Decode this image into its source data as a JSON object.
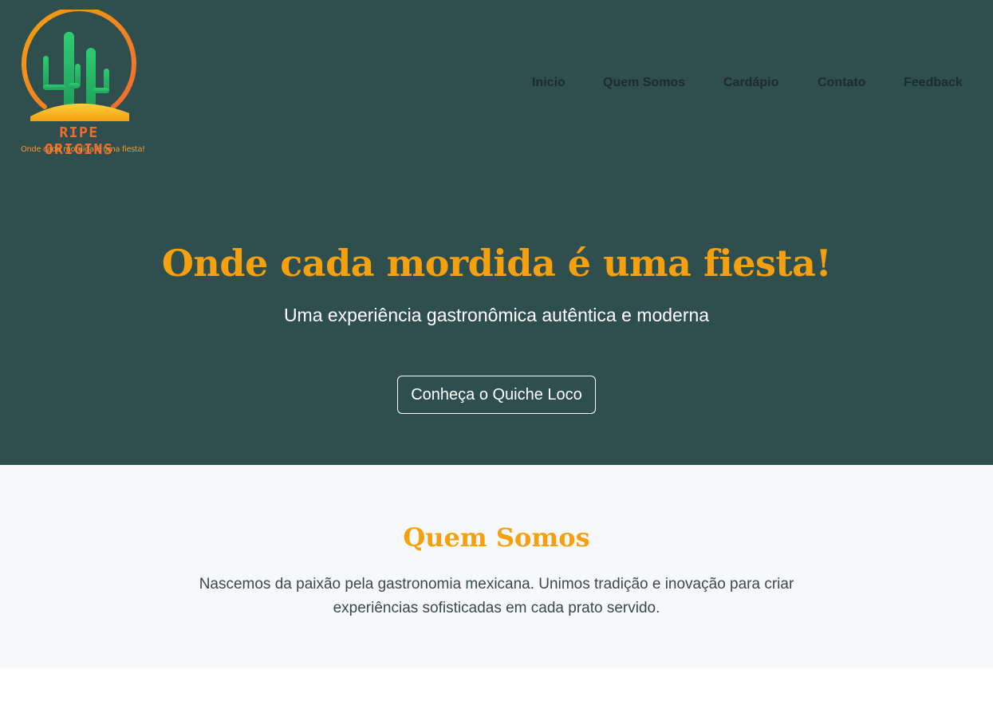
{
  "brand": {
    "name": "RIPE ORIGINS",
    "tagline": "Onde cada mordida é uma fiesta!",
    "logo_icon": "cactus-sun-icon",
    "colors": {
      "orange": "#f26b2e",
      "amber": "#f5a00f",
      "green": "#2ecc71"
    }
  },
  "nav": {
    "items": [
      {
        "label": "Inicio"
      },
      {
        "label": "Quem Somos"
      },
      {
        "label": "Cardápio"
      },
      {
        "label": "Contato"
      },
      {
        "label": "Feedback"
      }
    ]
  },
  "hero": {
    "title": "Onde cada mordida é uma fiesta!",
    "subtitle": "Uma experiência gastronômica autêntica e moderna",
    "cta_label": "Conheça o Quiche Loco",
    "background": "#2f4f4f"
  },
  "about": {
    "title": "Quem Somos",
    "text": "Nascemos da paixão pela gastronomia mexicana. Unimos tradição e inovação para criar experiências sofisticadas em cada prato servido."
  }
}
